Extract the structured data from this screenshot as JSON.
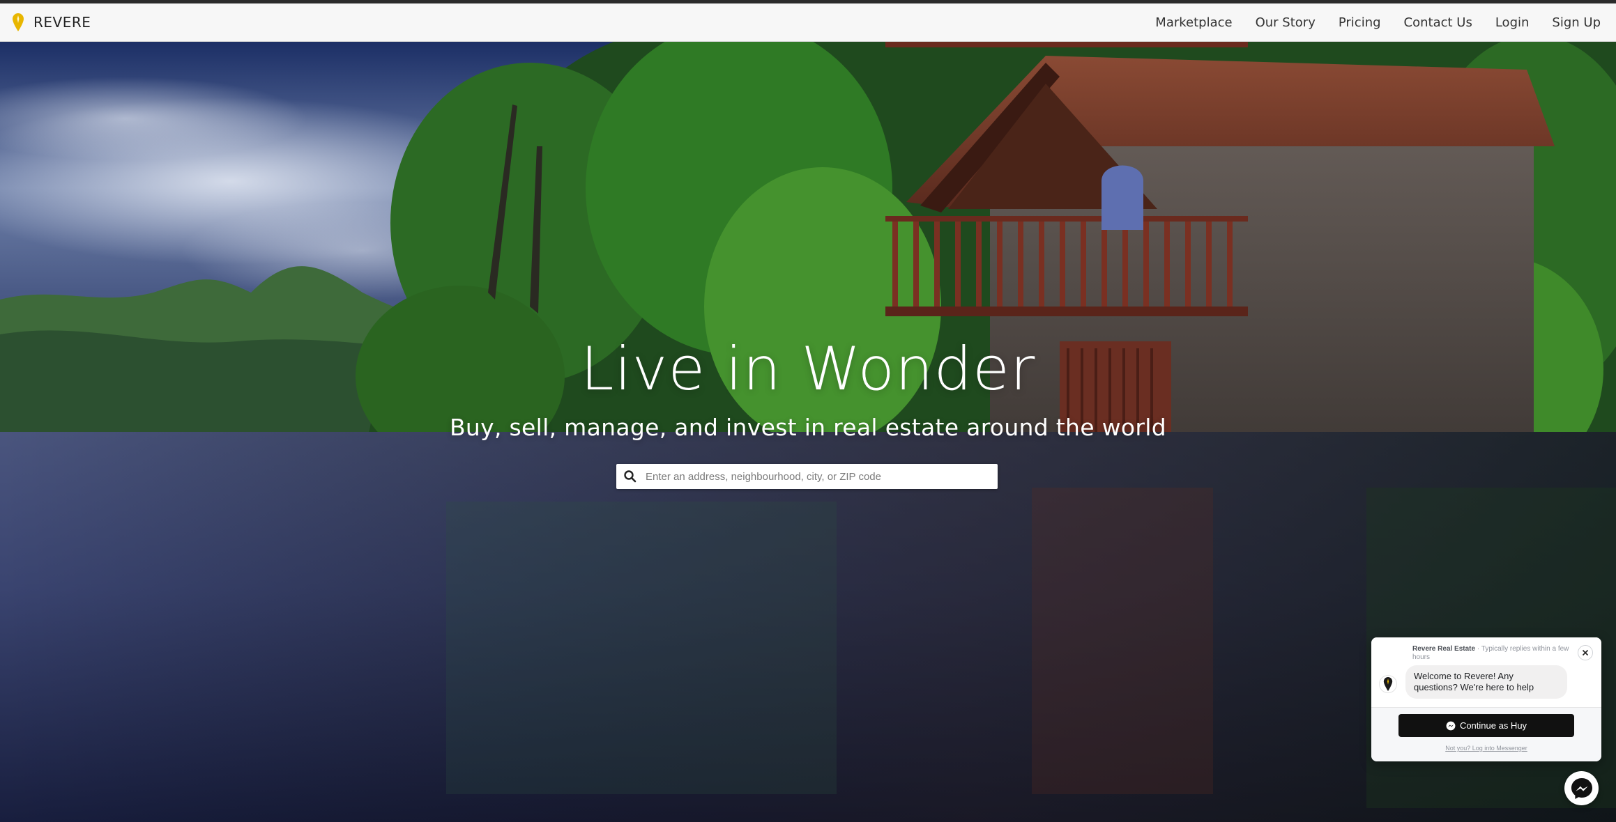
{
  "brand": {
    "name": "REVERE",
    "icon": "location-pin-icon",
    "accent_color": "#e8b600"
  },
  "nav": {
    "items": [
      {
        "label": "Marketplace"
      },
      {
        "label": "Our Story"
      },
      {
        "label": "Pricing"
      },
      {
        "label": "Contact Us"
      },
      {
        "label": "Login"
      },
      {
        "label": "Sign Up"
      }
    ]
  },
  "hero": {
    "title": "Live in Wonder",
    "subtitle": "Buy, sell, manage, and invest in real estate around the world",
    "background": "lake-boathouse-photo"
  },
  "search": {
    "placeholder": "Enter an address, neighbourhood, city, or ZIP code",
    "value": "",
    "icon": "search-icon"
  },
  "chat": {
    "sender": "Revere Real Estate",
    "status": " · Typically replies within a few hours",
    "message": "Welcome to Revere! Any questions? We're here to help",
    "continue_label": "Continue as Huy",
    "not_you_label": "Not you? Log into Messenger",
    "close_icon": "close-icon",
    "messenger_icon": "messenger-icon",
    "button_color": "#111111"
  }
}
